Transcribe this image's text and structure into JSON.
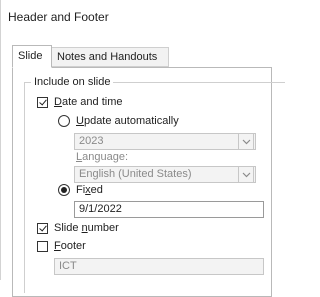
{
  "dialog": {
    "title": "Header and Footer"
  },
  "tabs": [
    {
      "label": "Slide",
      "active": true
    },
    {
      "label": "Notes and Handouts",
      "active": false
    }
  ],
  "include_group": {
    "label": "Include on slide"
  },
  "date_time": {
    "label": "Date and time",
    "access_key": "D",
    "label_rest": "ate and time",
    "checked": true,
    "update_auto": {
      "label_key": "U",
      "label_rest": "pdate automatically",
      "selected": false,
      "value": "2023",
      "language_label_key": "L",
      "language_label_rest": "anguage:",
      "language_value": "English (United States)"
    },
    "fixed": {
      "label_pre": "Fi",
      "label_key": "x",
      "label_rest": "ed",
      "selected": true,
      "value": "9/1/2022"
    }
  },
  "slide_number": {
    "label_pre": "Slide ",
    "label_key": "n",
    "label_rest": "umber",
    "checked": true
  },
  "footer": {
    "label_key": "F",
    "label_rest": "ooter",
    "checked": false,
    "value": "ICT"
  }
}
